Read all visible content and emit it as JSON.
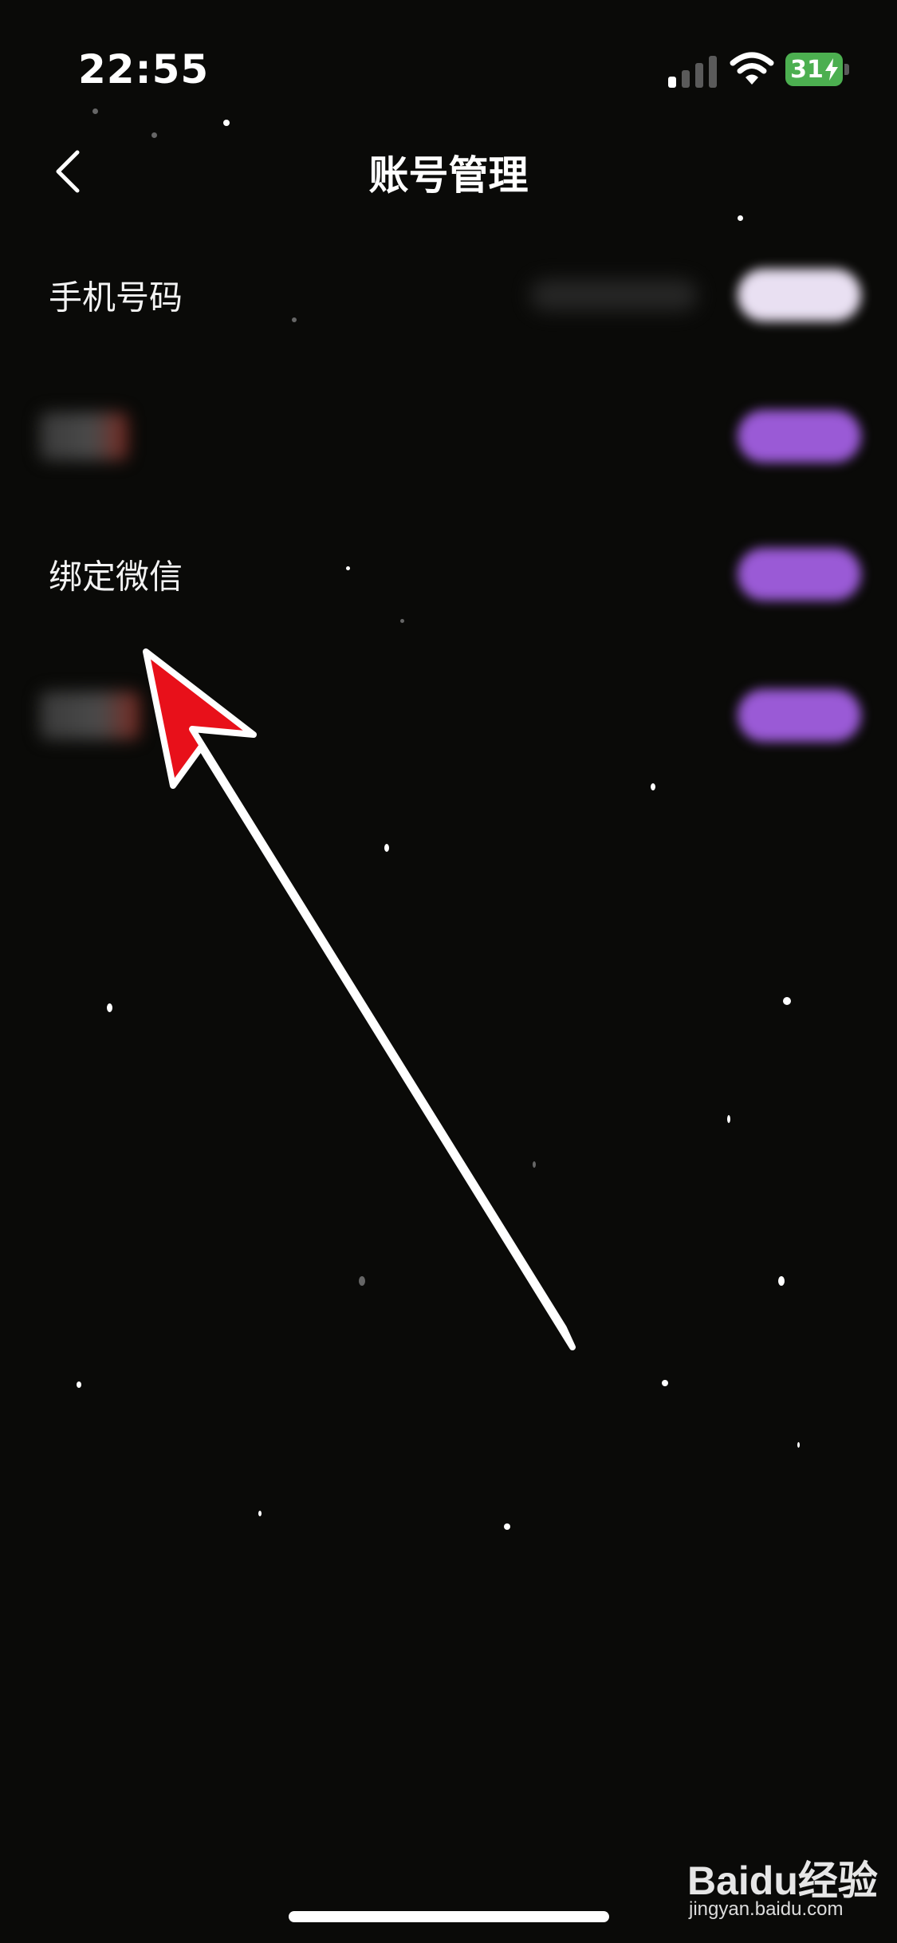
{
  "status_bar": {
    "time": "22:55",
    "battery_level": "31",
    "battery_color": "#4caf50",
    "signal_bars_active": 1,
    "signal_bars_total": 4
  },
  "nav": {
    "title": "账号管理",
    "back_icon": "chevron-left-icon"
  },
  "rows": [
    {
      "label": "手机号码"
    },
    {
      "label": ""
    },
    {
      "label": "绑定微信"
    },
    {
      "label": ""
    }
  ],
  "colors": {
    "background": "#0a0a08",
    "accent_purple": "#9a5ad6",
    "arrow_red": "#e8101a"
  },
  "watermark": {
    "main": "Baidu经验",
    "sub": "jingyan.baidu.com"
  }
}
